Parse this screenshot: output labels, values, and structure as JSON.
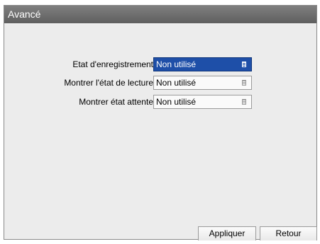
{
  "window": {
    "title": "Avancé"
  },
  "settings": [
    {
      "label": "Etat d'enregistrement",
      "value": "Non utilisé",
      "active": true
    },
    {
      "label": "Montrer l'état de lecture",
      "value": "Non utilisé",
      "active": false
    },
    {
      "label": "Montrer état attente",
      "value": "Non utilisé",
      "active": false
    }
  ],
  "buttons": {
    "apply": "Appliquer",
    "back": "Retour"
  },
  "colors": {
    "title_bar": "#6f6f6f",
    "panel_background": "#ececec",
    "selected_field": "#1e4fa8"
  },
  "icons": {
    "dropdown": "list-icon"
  }
}
